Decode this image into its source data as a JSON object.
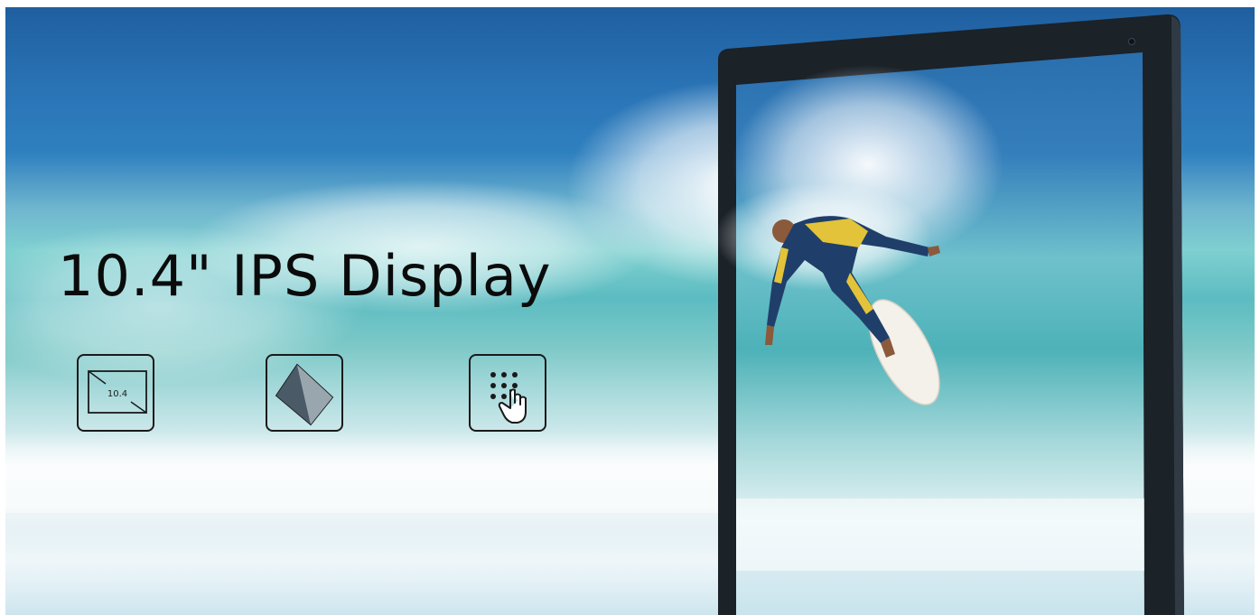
{
  "banner": {
    "headline": "10.4\" IPS Display",
    "features": [
      {
        "icon": "screen-size-icon",
        "label": "10.4"
      },
      {
        "icon": "ips-panel-icon"
      },
      {
        "icon": "multi-touch-icon"
      }
    ]
  },
  "colors": {
    "text": "#0b0b0b",
    "ocean_deep": "#1f5fa0",
    "wave_teal": "#5cbcc1",
    "tablet_frame": "#1b2228"
  }
}
